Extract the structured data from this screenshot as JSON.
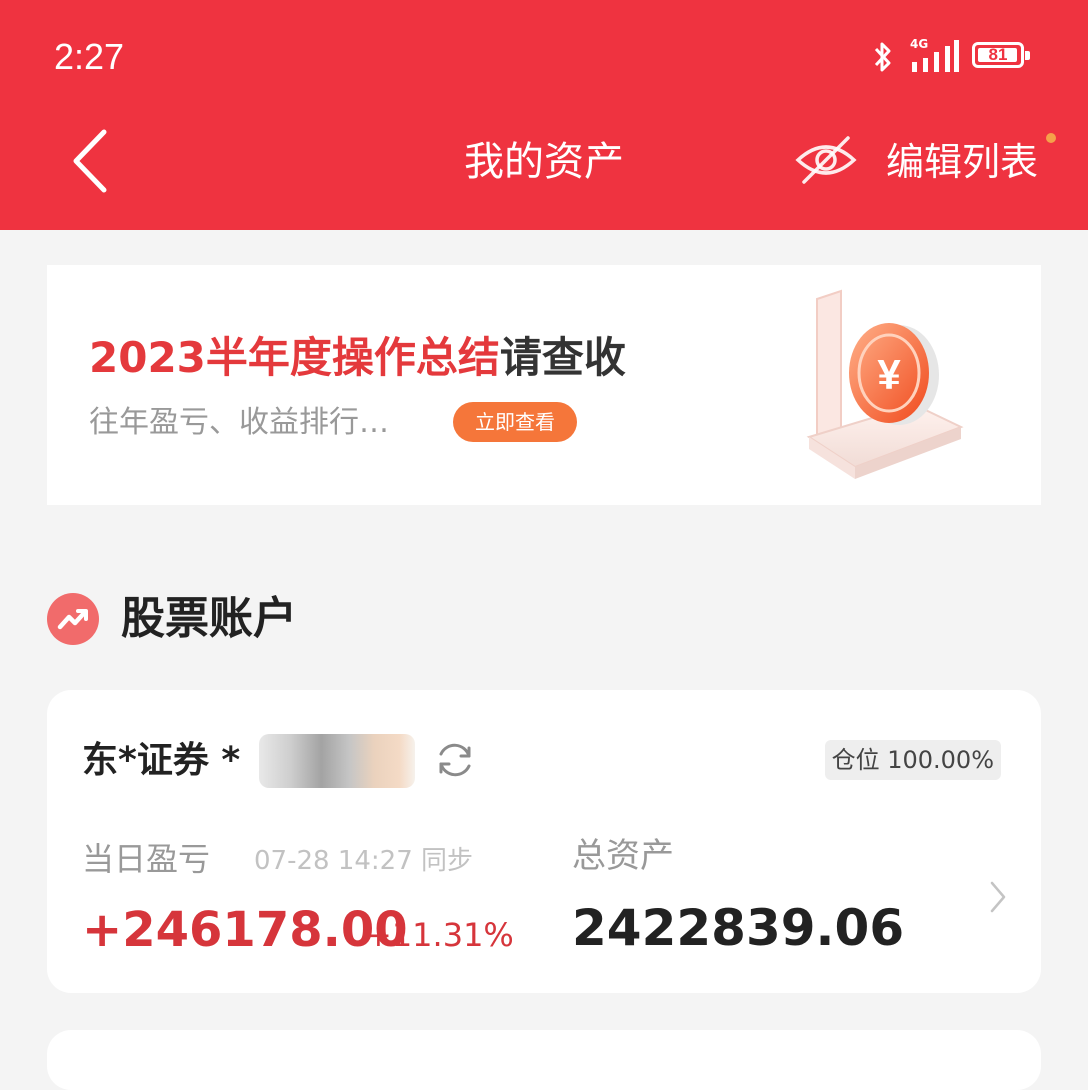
{
  "status_bar": {
    "time": "2:27",
    "network": "4G",
    "battery": "81",
    "icons": [
      "bluetooth-icon",
      "signal-icon",
      "battery-icon"
    ]
  },
  "nav": {
    "title": "我的资产",
    "edit_label": "编辑列表",
    "icons": [
      "back-arrow-icon",
      "eye-off-icon"
    ]
  },
  "banner": {
    "title_highlight": "2023半年度操作总结",
    "title_rest": "请查收",
    "subtitle": "往年盈亏、收益排行…",
    "button_label": "立即查看",
    "illustration": "yuan-coin-illustration"
  },
  "section": {
    "title": "股票账户",
    "icon": "stock-trend-icon"
  },
  "account": {
    "name": "东*证券 *",
    "position_label": "仓位",
    "position_value": "100.00%",
    "daily_pnl_label": "当日盈亏",
    "sync_time": "07-28 14:27 同步",
    "daily_pnl_value": "+246178.00",
    "daily_pnl_percent": "+11.31%",
    "total_assets_label": "总资产",
    "total_assets_value": "2422839.06",
    "icons": [
      "refresh-icon",
      "chevron-right-icon"
    ]
  },
  "colors": {
    "header_red": "#ef3340",
    "gain_red": "#d6353b",
    "badge_orange": "#f5763a",
    "notify_dot": "#f5a14a"
  }
}
